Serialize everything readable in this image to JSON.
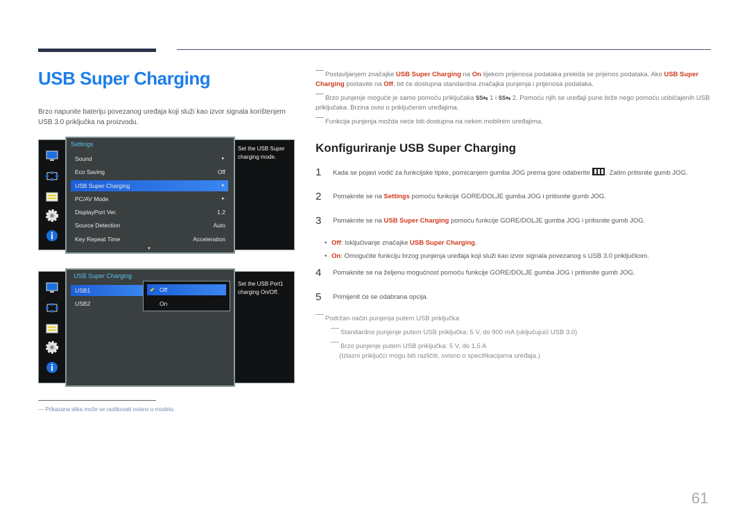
{
  "page": {
    "title": "USB Super Charging",
    "intro": "Brzo napunite bateriju povezanog uređaja koji služi kao izvor signala korištenjem USB 3.0 priključka na proizvodu.",
    "page_number": "61",
    "footnote": "Prikazana slika može se razlikovati ovisno o modelu.",
    "footnote_marker": "―",
    "accent_color": "#1d7ee8",
    "highlight_color": "#d03a1b"
  },
  "osd1": {
    "header": "Settings",
    "description": "Set the USB Super charging mode.",
    "rows": [
      {
        "label": "Sound",
        "value": "►"
      },
      {
        "label": "Eco Saving",
        "value": "Off"
      },
      {
        "label": "USB Super Charging",
        "value": "►",
        "selected": true
      },
      {
        "label": "PC/AV Mode",
        "value": "►"
      },
      {
        "label": "DisplayPort Ver.",
        "value": "1.2"
      },
      {
        "label": "Source Detection",
        "value": "Auto"
      },
      {
        "label": "Key Repeat Time",
        "value": "Acceleration"
      }
    ],
    "scroll_indicator": "▼"
  },
  "osd2": {
    "header": "USB Super Charging",
    "description": "Set the USB Port1 charging On/Off.",
    "rows": [
      {
        "label": "USB1",
        "selected": true
      },
      {
        "label": "USB2"
      }
    ],
    "popup": {
      "options": [
        {
          "label": "Off",
          "checked": true
        },
        {
          "label": "On"
        }
      ],
      "check_glyph": "✔"
    }
  },
  "notes": [
    {
      "parts": [
        "Postavljanjem značajke ",
        "USB Super Charging",
        " na ",
        "On",
        " tijekom prijenosa podataka prekida se prijenos podataka. Ako ",
        "USB Super Charging",
        " postavite na ",
        "Off",
        ", bit će dostupna standardna značajka punjenja i prijenosa podataka."
      ]
    },
    {
      "parts": [
        "Brzo punjenje moguće je samo pomoću priključaka ",
        "SS⇆",
        " 1 i ",
        "SS⇆",
        " 2. Pomoću njih se uređaji pune brže nego pomoću uobičajenih USB priključaka. Brzina ovisi o priključenim uređajima."
      ]
    },
    {
      "parts": [
        "Funkcija punjenja možda neće biti dostupna na nekim mobilnim uređajima."
      ]
    }
  ],
  "section": {
    "heading": "Konfiguriranje USB Super Charging",
    "steps": [
      {
        "num": "1",
        "before": "Kada se pojavi vodič za funkcijske tipke, pomicanjem gumba JOG prema gore odaberite ",
        "after": ". Zatim pritisnite gumb JOG."
      },
      {
        "num": "2",
        "before": "Pomaknite se na ",
        "hl": "Settings",
        "after": " pomoću funkcije GORE/DOLJE gumba JOG i pritisnite gumb JOG."
      },
      {
        "num": "3",
        "before": "Pomaknite se na ",
        "hl": "USB Super Charging",
        "after": " pomoću funkcije GORE/DOLJE gumba JOG i pritisnite gumb JOG."
      },
      {
        "num": "4",
        "text": "Pomaknite se na željenu mogućnost pomoću funkcije GORE/DOLJE gumba JOG i pritisnite gumb JOG."
      },
      {
        "num": "5",
        "text": "Primijenit će se odabrana opcija."
      }
    ],
    "bullets": [
      {
        "key": "Off",
        "text": ": Isključivanje značajke ",
        "hl2": "USB Super Charging",
        "end": "."
      },
      {
        "key": "On",
        "text": ": Omogućite funkciju brzog punjenja uređaja koji služi kao izvor signala povezanog s USB 3.0 priključkom."
      }
    ],
    "bullet_glyph": "•"
  },
  "support": {
    "title": "Podržan način punjenja putem USB priključka",
    "standard": "Standardno punjenje putem USB priključka: 5 V, do 900 mA (uključujući USB 3.0)",
    "fast": "Brzo punjenje putem USB priključka: 5 V, do 1,5 A",
    "fast_note": "(Izlazni priključci mogu biti različiti, ovisno o specifikacijama uređaja.)"
  }
}
